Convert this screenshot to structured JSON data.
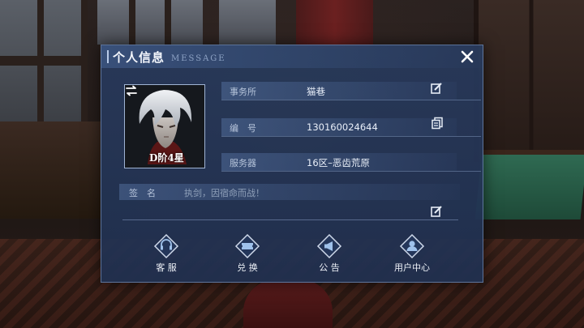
{
  "dialog": {
    "title": "个人信息",
    "subtitle": "MESSAGE"
  },
  "avatar": {
    "rank": "D阶4星"
  },
  "info": {
    "office_label": "事务所",
    "office_value": "猫巷",
    "id_label": "编　号",
    "id_value": "130160024644",
    "server_label": "服务器",
    "server_value": "16区–恶齿荒原"
  },
  "signature": {
    "label": "签　名",
    "value": "执剑，因宿命而战！"
  },
  "actions": [
    {
      "label": "客 服",
      "icon": "headset-icon"
    },
    {
      "label": "兑 换",
      "icon": "ticket-icon"
    },
    {
      "label": "公 告",
      "icon": "megaphone-icon"
    },
    {
      "label": "用户中心",
      "icon": "user-icon"
    }
  ],
  "colors": {
    "panel": "#283a5c",
    "accent": "#9fb3d3",
    "text": "#e8eef8"
  }
}
